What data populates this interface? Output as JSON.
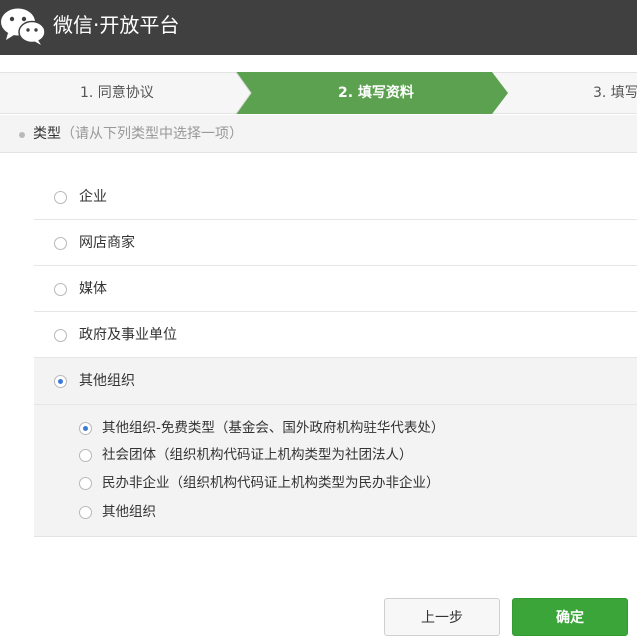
{
  "header": {
    "brand": "微信·开放平台",
    "logo_icon": "wechat-logo-icon",
    "bg_color": "#404040"
  },
  "steps": [
    {
      "label": "1. 同意协议",
      "active": false
    },
    {
      "label": "2. 填写资料",
      "active": true
    },
    {
      "label": "3. 填写"
    }
  ],
  "section": {
    "title": "类型",
    "hint": "（请从下列类型中选择一项）"
  },
  "options": [
    {
      "label": "企业",
      "checked": false
    },
    {
      "label": "网店商家",
      "checked": false
    },
    {
      "label": "媒体",
      "checked": false
    },
    {
      "label": "政府及事业单位",
      "checked": false
    },
    {
      "label": "其他组织",
      "checked": true
    }
  ],
  "sub_options": [
    {
      "label": "其他组织-免费类型（基金会、国外政府机构驻华代表处）",
      "checked": true
    },
    {
      "label": "社会团体（组织机构代码证上机构类型为社团法人）",
      "checked": false
    },
    {
      "label": "民办非企业（组织机构代码证上机构类型为民办非企业）",
      "checked": false
    },
    {
      "label": "其他组织",
      "checked": false
    }
  ],
  "buttons": {
    "prev": "上一步",
    "confirm": "确定"
  },
  "colors": {
    "active_step": "#5ba14f",
    "confirm": "#3ca53a",
    "radio_checked": "#3c7ad7"
  }
}
